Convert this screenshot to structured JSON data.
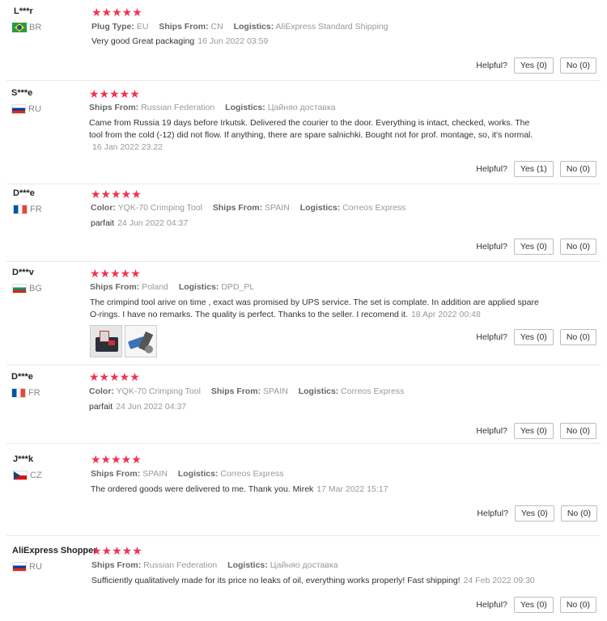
{
  "helpful_label": "Helpful?",
  "labels": {
    "plug_type": "Plug Type:",
    "ships_from": "Ships From:",
    "logistics": "Logistics:",
    "color": "Color:"
  },
  "colors": {
    "star": "#f0334f"
  },
  "reviews": [
    {
      "user": "L***r",
      "country": "BR",
      "flag": "brazil-flag-icon",
      "stars": "★★★★★",
      "plug_type": "EU",
      "ships_from": "CN",
      "logistics": "AliExpress Standard Shipping",
      "text": "Very good Great packaging",
      "date": "16 Jun 2022 03:59",
      "yes": "Yes (0)",
      "no": "No (0)"
    },
    {
      "user": "S***e",
      "country": "RU",
      "flag": "russia-flag-icon",
      "stars": "★★★★★",
      "ships_from": "Russian Federation",
      "logistics": "Цайняо доставка",
      "text": "Came from Russia 19 days before Irkutsk. Delivered the courier to the door. Everything is intact, checked, works. The tool from the cold (-12) did not flow. If anything, there are spare salnichki. Bought not for prof. montage, so, it's normal.",
      "date": "16 Jan 2022 23:22",
      "yes": "Yes (1)",
      "no": "No (0)"
    },
    {
      "user": "D***e",
      "country": "FR",
      "flag": "france-flag-icon",
      "stars": "★★★★★",
      "color": "YQK-70 Crimping Tool",
      "ships_from": "SPAIN",
      "logistics": "Correos Express",
      "text": "parfait",
      "date": "24 Jun 2022 04:37",
      "yes": "Yes (0)",
      "no": "No (0)"
    },
    {
      "user": "D***v",
      "country": "BG",
      "flag": "bulgaria-flag-icon",
      "stars": "★★★★★",
      "ships_from": "Poland",
      "logistics": "DPD_PL",
      "text": "The crimpind tool arive on time , exact was promised by UPS service. The set is complate. In addition are applied spare O-rings. I have no remarks. The quality is perfect. Thanks to the seller. I recomend it.",
      "date": "18 Apr 2022 00:48",
      "yes": "Yes (0)",
      "no": "No (0)"
    },
    {
      "user": "D***e",
      "country": "FR",
      "flag": "france-flag-icon",
      "stars": "★★★★★",
      "color": "YQK-70 Crimping Tool",
      "ships_from": "SPAIN",
      "logistics": "Correos Express",
      "text": "parfait",
      "date": "24 Jun 2022 04:37",
      "yes": "Yes (0)",
      "no": "No (0)"
    },
    {
      "user": "J***k",
      "country": "CZ",
      "flag": "czech-flag-icon",
      "stars": "★★★★★",
      "ships_from": "SPAIN",
      "logistics": "Correos Express",
      "text": "The ordered goods were delivered to me. Thank you. Mirek",
      "date": "17 Mar 2022 15:17",
      "yes": "Yes (0)",
      "no": "No (0)"
    },
    {
      "user": "AliExpress Shopper",
      "country": "RU",
      "flag": "russia-flag-icon",
      "stars": "★★★★★",
      "ships_from": "Russian Federation",
      "logistics": "Цайняо доставка",
      "text": "Sufficiently qualitatively made for its price no leaks of oil, everything works properly! Fast shipping!",
      "date": "24 Feb 2022 09:30",
      "yes": "Yes (0)",
      "no": "No (0)"
    }
  ]
}
